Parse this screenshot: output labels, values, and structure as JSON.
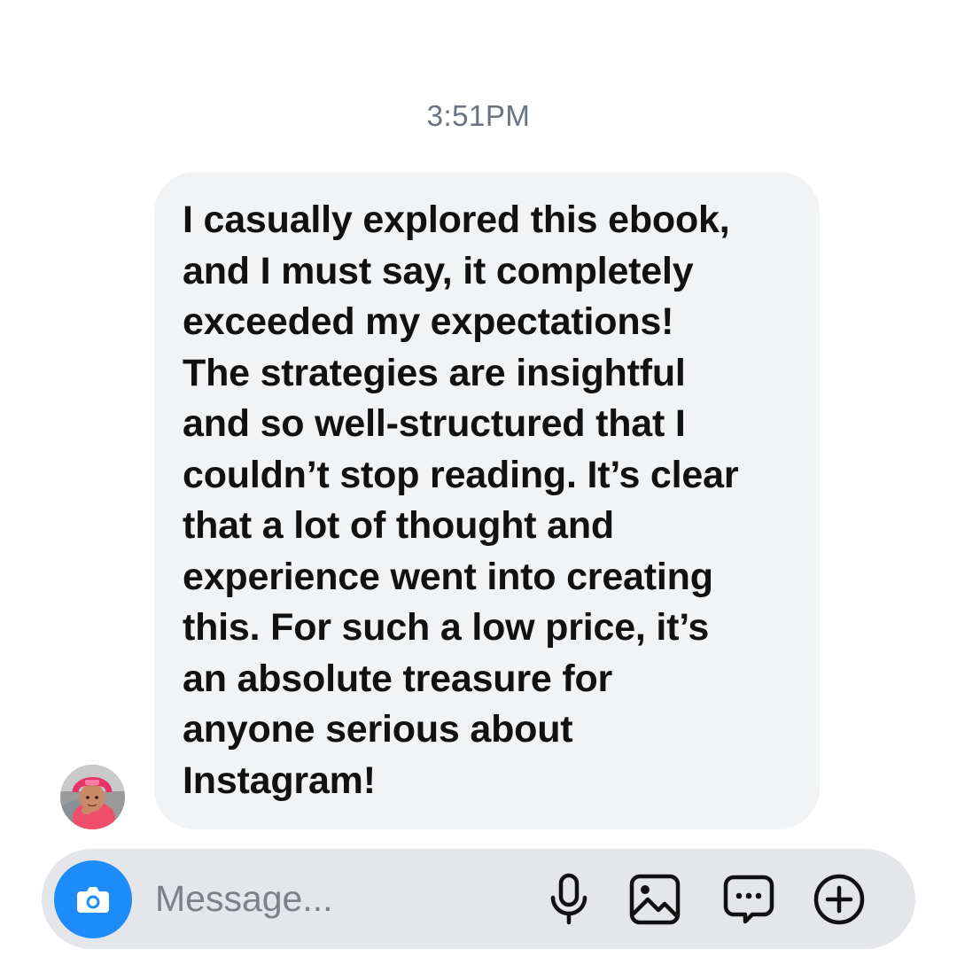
{
  "conversation": {
    "timestamp": "3:51PM",
    "message": {
      "text": "I casually explored this ebook,\nand I must say, it completely\nexceeded my expectations!\nThe strategies are insightful\nand so well-structured that I\ncouldn’t stop reading. It’s clear\nthat a lot of thought and\nexperience went into creating\nthis. For such a low price, it’s\nan absolute treasure for\nanyone serious about\nInstagram!"
    }
  },
  "composer": {
    "placeholder": "Message...",
    "icons": [
      "camera-icon",
      "microphone-icon",
      "gallery-icon",
      "sticker-icon",
      "plus-icon"
    ]
  },
  "colors": {
    "bubble_bg": "#f2f3f5",
    "camera_button": "#1d8bf8",
    "composer_bg": "#e4e6ea",
    "timestamp": "#6b7280"
  }
}
